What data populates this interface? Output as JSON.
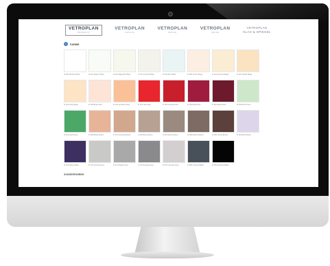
{
  "header": {
    "logos": [
      {
        "name": "VETROPLAN",
        "sub": "PRODUCTS",
        "boxed": true
      },
      {
        "name": "VETROPLAN",
        "sub": "CATALOG",
        "boxed": false
      },
      {
        "name": "VETROPLAN",
        "sub": "DESIGN",
        "boxed": false
      },
      {
        "name": "VETROPLAN",
        "sub": "ONLINE",
        "boxed": false
      }
    ],
    "text_logo": {
      "line1": "VETROPLAN",
      "line2": "GLAS & SPIEGEL"
    }
  },
  "section": {
    "icon": "info-icon",
    "icon_glyph": "i",
    "title": "FARBE"
  },
  "swatches": [
    {
      "label": "R 100 Absolut White",
      "color": "#ffffff"
    },
    {
      "label": "R 111 Glacier White",
      "color": "#f9fbf6"
    },
    {
      "label": "R 112 Magnolia White",
      "color": "#f6f8ee"
    },
    {
      "label": "L 113 Linecast White",
      "color": "#f3f3ec"
    },
    {
      "label": "R 114 Mint White",
      "color": "#e9f4f4"
    },
    {
      "label": "R 180 Green Beige",
      "color": "#fcefe1"
    },
    {
      "label": "R 121 Linecast Beige",
      "color": "#fbecd4"
    },
    {
      "label": "R 122 Vanilla Beige",
      "color": "#fbe3c1"
    },
    {
      "label": "R 123 Crisp Beige",
      "color": "#fde4c5"
    },
    {
      "label": "R 130 Blush Red",
      "color": "#fde4d7"
    },
    {
      "label": "R 131 Sunshine Red",
      "color": "#fac097"
    },
    {
      "label": "R 151 Ultra Red",
      "color": "#e9252e"
    },
    {
      "label": "R 152 Linecast Red",
      "color": "#c71f2c"
    },
    {
      "label": "R 153 Ruby Red",
      "color": "#a01c3e"
    },
    {
      "label": "R 155 Merlot Red",
      "color": "#6c1a2c"
    },
    {
      "label": "R 156 Mint Green",
      "color": "#cce8c8"
    },
    {
      "label": "R 161 Leaf Green",
      "color": "#4ca867"
    },
    {
      "label": "R 166 Blush Brown",
      "color": "#e7b499"
    },
    {
      "label": "R 167 Linecast Brown",
      "color": "#d1a88e"
    },
    {
      "label": "L 195 Grain Brown",
      "color": "#b7a193"
    },
    {
      "label": "R 162 Stone Brown",
      "color": "#9a8a80"
    },
    {
      "label": "R 168 Mocha Brown",
      "color": "#7e6b63"
    },
    {
      "label": "R 160 Cocoa Brown",
      "color": "#5b403c"
    },
    {
      "label": "R 164 Mist Mauve",
      "color": "#ddd5ea"
    },
    {
      "label": "R 141 Velvety Blue",
      "color": "#3d3060"
    },
    {
      "label": "R 175 Smooth Grey",
      "color": "#c9c9c7"
    },
    {
      "label": "R 171 Plastic Grey",
      "color": "#a9a9a9"
    },
    {
      "label": "L 173 Linecast Grey",
      "color": "#8a898c"
    },
    {
      "label": "R 176 Linecast Grey",
      "color": "#d3cfd1"
    },
    {
      "label": "R 180 Cement Black",
      "color": "#48505a"
    },
    {
      "label": "R 181 Absolute Black",
      "color": "#050505"
    }
  ],
  "footer": {
    "heading": "SONDERFARBEN"
  }
}
